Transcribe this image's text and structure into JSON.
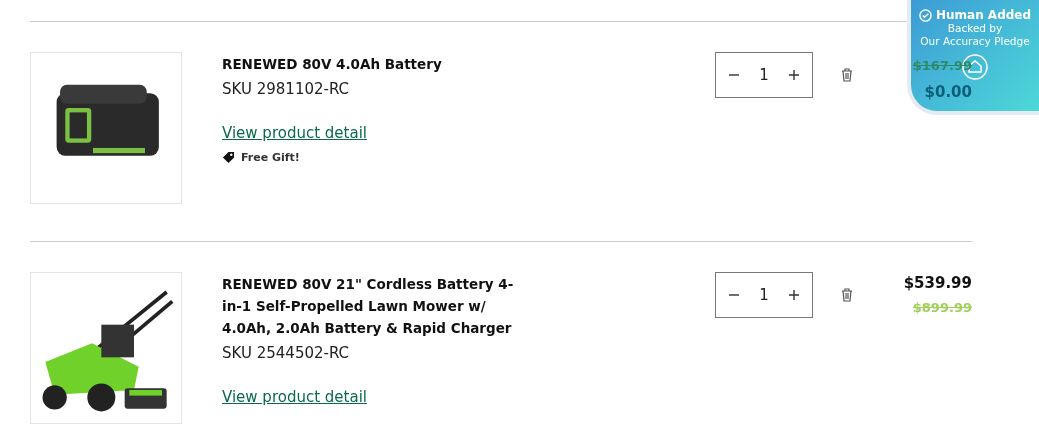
{
  "items": [
    {
      "title": "RENEWED 80V 4.0Ah Battery",
      "sku": "SKU 2981102-RC",
      "link": "View product detail",
      "gift": "Free Gift!",
      "quantity": "1",
      "price": "$0.00",
      "original_price": "$167.99",
      "kind": "battery"
    },
    {
      "title": "RENEWED 80V 21\" Cordless Battery 4-in-1 Self-Propelled Lawn Mower w/ 4.0Ah, 2.0Ah Battery & Rapid Charger",
      "sku": "SKU 2544502-RC",
      "link": "View product detail",
      "quantity": "1",
      "price": "$539.99",
      "original_price": "$899.99",
      "kind": "mower"
    }
  ],
  "badge": {
    "title": "Human Added",
    "subtitle": "Backed by",
    "pledge": "Our Accuracy Pledge"
  }
}
